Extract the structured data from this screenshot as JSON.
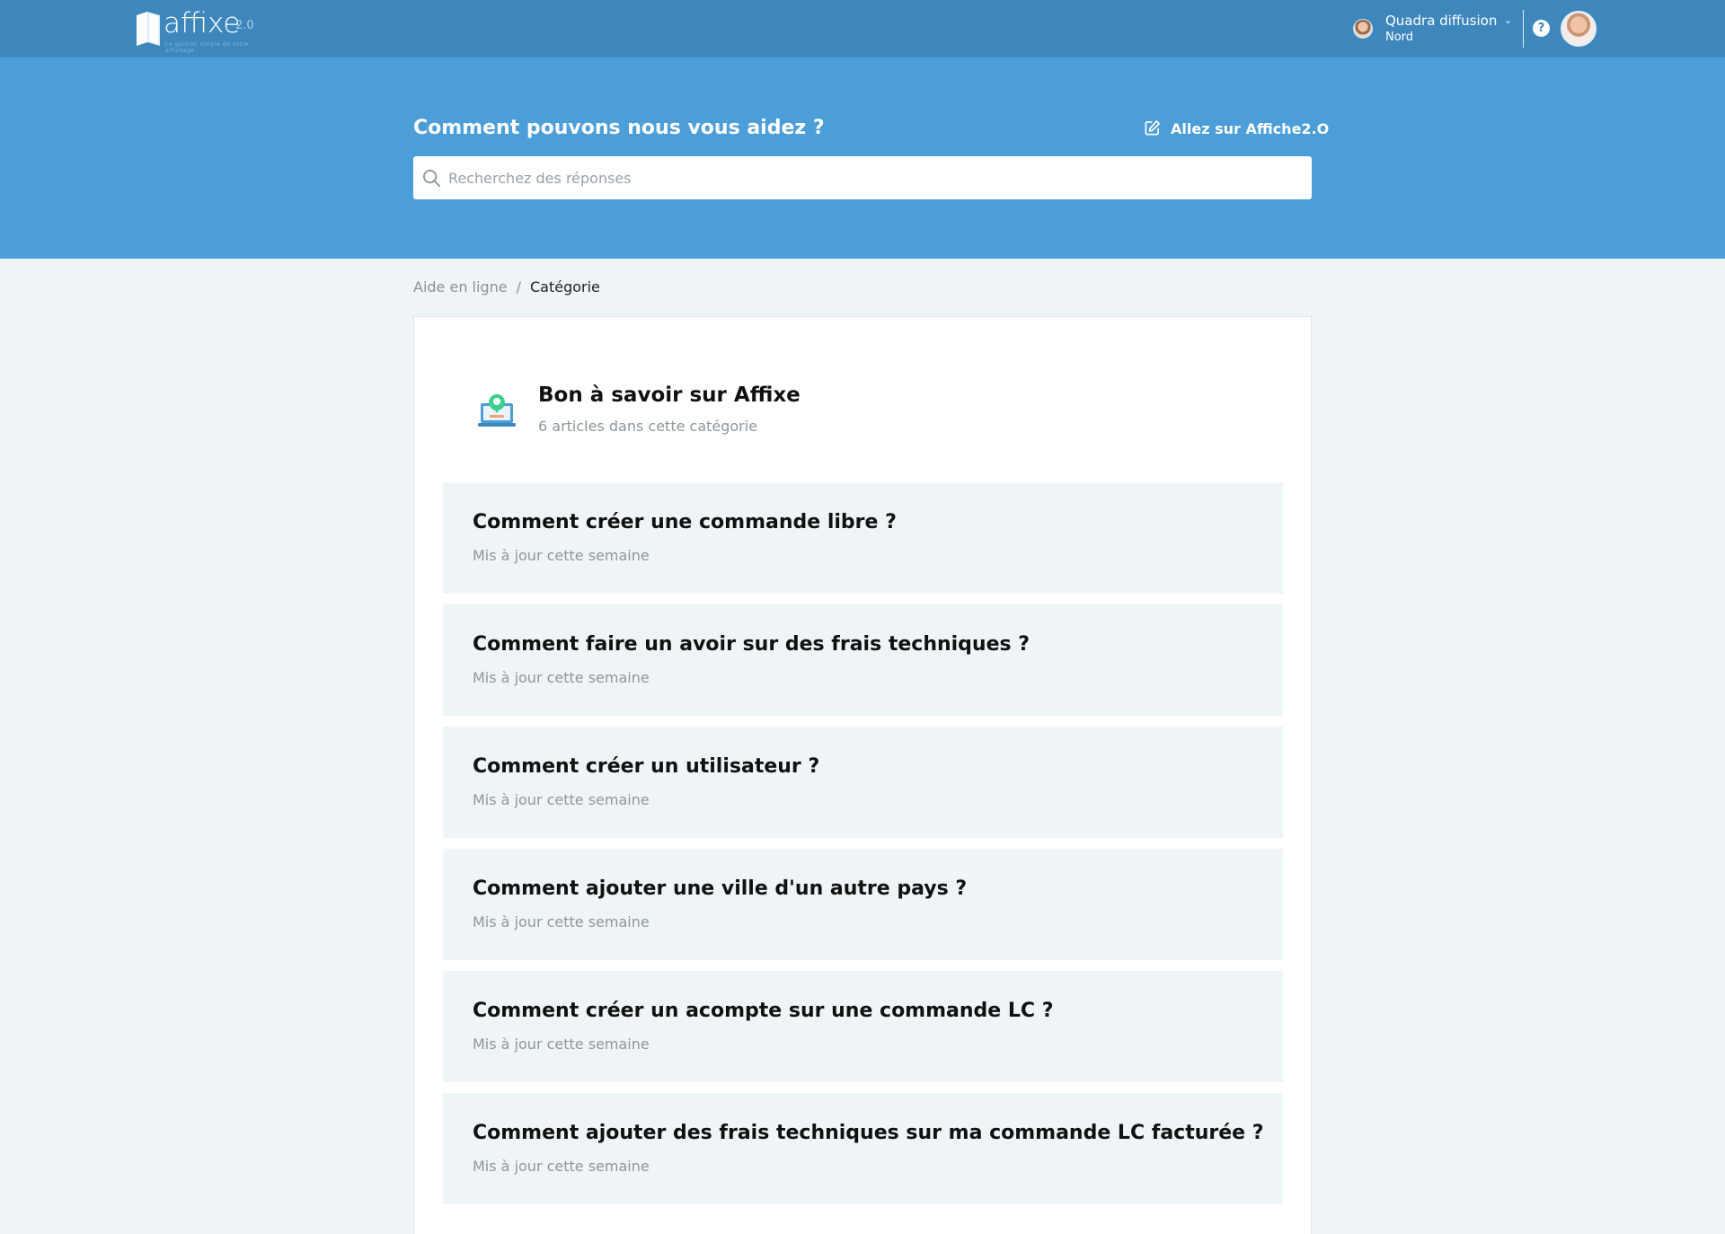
{
  "header": {
    "logo_word": "affixe",
    "logo_version": "2.0",
    "logo_tagline": "La gestion simple de votre affichage",
    "org_name": "Quadra diffusion",
    "org_sub": "Nord",
    "help_glyph": "?"
  },
  "hero": {
    "title": "Comment pouvons nous vous aidez ?",
    "goto_label": "Allez sur Affiche2.O",
    "search_placeholder": "Recherchez des réponses"
  },
  "breadcrumb": {
    "link": "Aide en ligne",
    "separator": "/",
    "current": "Catégorie"
  },
  "category": {
    "title": "Bon à savoir sur Affixe",
    "count": "6 articles dans cette catégorie"
  },
  "articles": [
    {
      "title": "Comment créer une commande libre ?",
      "meta": "Mis à jour cette semaine"
    },
    {
      "title": "Comment faire un avoir sur des frais techniques ?",
      "meta": "Mis à jour cette semaine"
    },
    {
      "title": "Comment créer un utilisateur ?",
      "meta": "Mis à jour cette semaine"
    },
    {
      "title": "Comment ajouter une ville d'un autre pays ?",
      "meta": "Mis à jour cette semaine"
    },
    {
      "title": "Comment créer un acompte sur une commande LC ?",
      "meta": "Mis à jour cette semaine"
    },
    {
      "title": "Comment ajouter des frais techniques sur ma commande LC facturée ?",
      "meta": "Mis à jour cette semaine"
    }
  ],
  "colors": {
    "topbar": "#3d87bd",
    "hero": "#4b9ed8",
    "page_bg": "#eff4f7"
  },
  "icons": [
    "book-logo-icon",
    "chevron-down-icon",
    "help-icon",
    "edit-icon",
    "search-icon",
    "laptop-support-icon"
  ]
}
